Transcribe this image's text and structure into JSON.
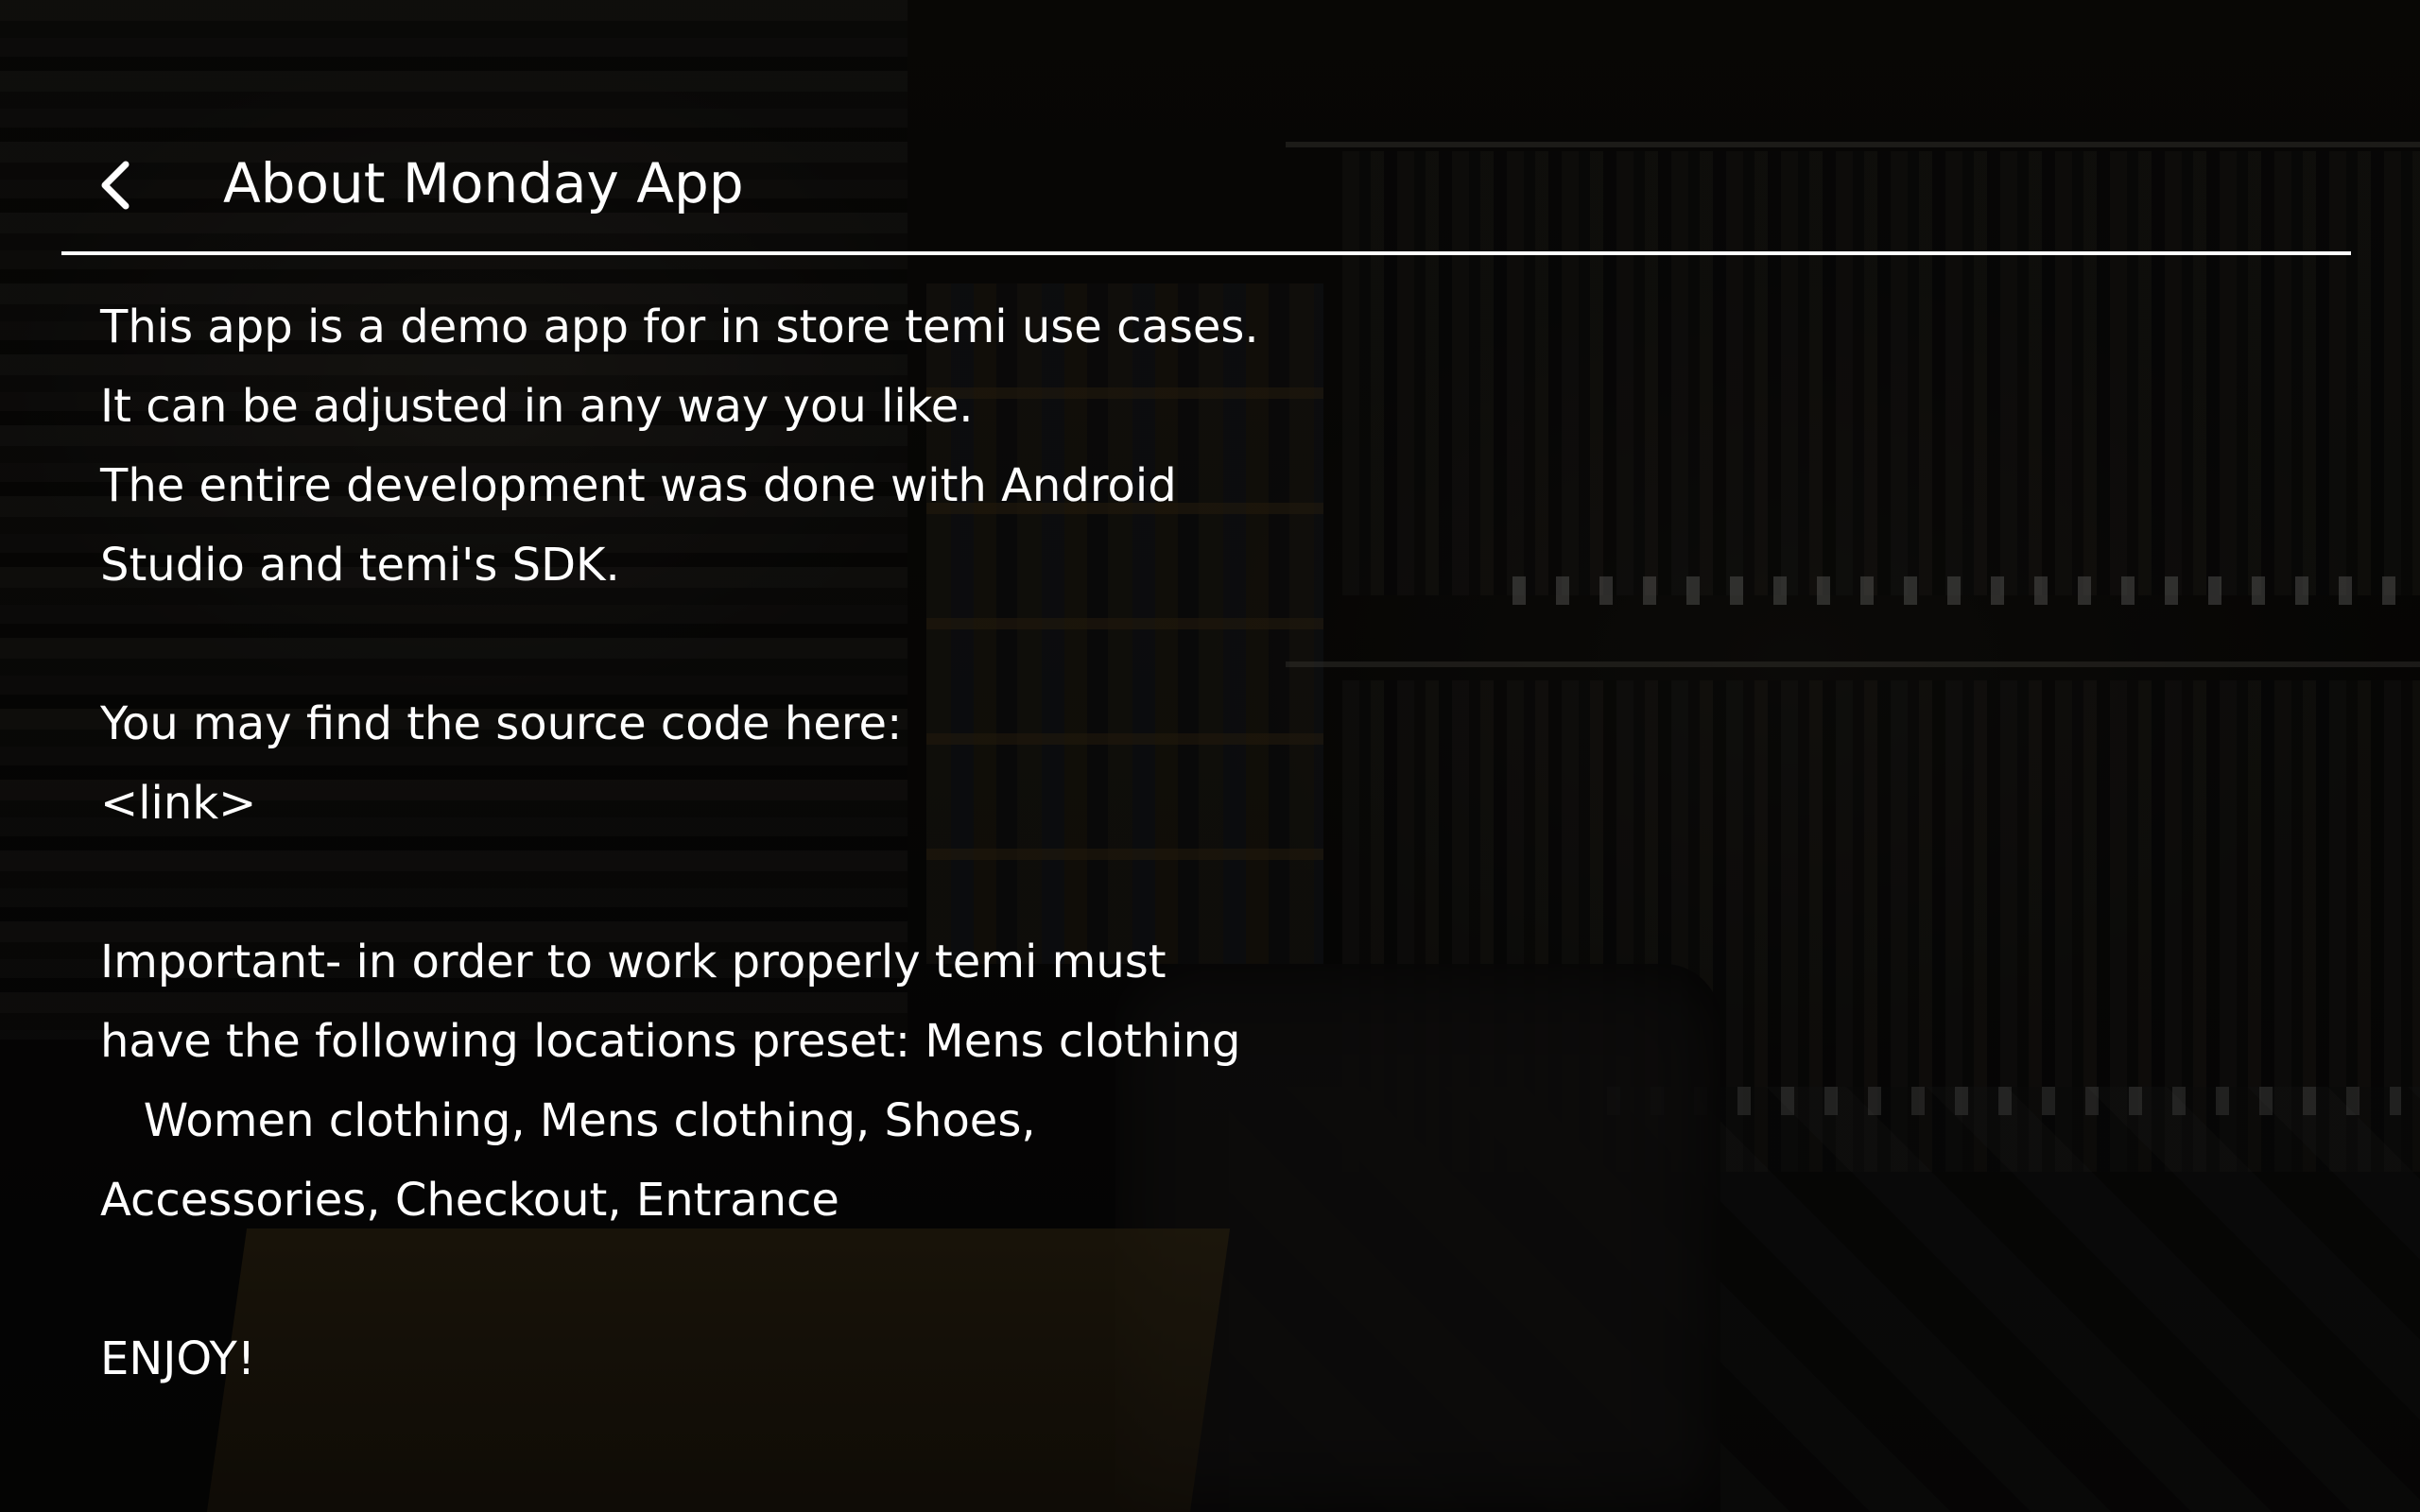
{
  "header": {
    "title": "About Monday App",
    "back_icon": "chevron-left-icon"
  },
  "content": {
    "lines": [
      "This app is a demo app for in store temi use cases.",
      "It can be adjusted in any way you like.",
      "The entire development was done with Android",
      "Studio and temi's SDK.",
      "",
      "You may find the source code here:",
      "<link>",
      "",
      "Important- in order to work properly temi must",
      "have the following locations preset: Mens clothing",
      "   Women clothing, Mens clothing, Shoes,",
      "Accessories, Checkout, Entrance",
      "",
      "ENJOY!"
    ]
  },
  "colors": {
    "text": "#ffffff",
    "divider": "#ffffff",
    "overlay": "#000000"
  }
}
